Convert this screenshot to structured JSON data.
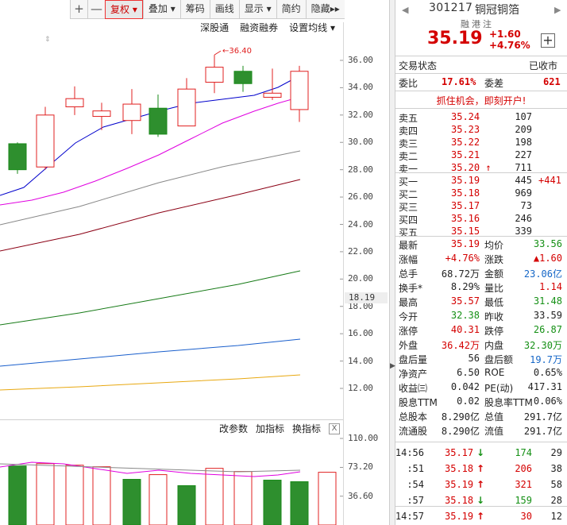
{
  "toolbar": {
    "items": [
      "+",
      "—",
      "复权",
      "叠加",
      "筹码",
      "画线",
      "显示",
      "简约",
      "隐藏"
    ],
    "fuquan_caret": "▾",
    "diejia_caret": "▾",
    "display_caret": "▾",
    "hide_arrow": "▸▸"
  },
  "subbar": {
    "shengutong": "深股通",
    "rongzi": "融资融券",
    "setma": "设置均线"
  },
  "chart": {
    "high_label": "36.40",
    "y_ticks": [
      "36.00",
      "34.00",
      "32.00",
      "30.00",
      "28.00",
      "26.00",
      "24.00",
      "22.00",
      "20.00",
      "18.00",
      "16.00",
      "14.00",
      "12.00"
    ],
    "current": "18.19",
    "ind_ticks": [
      "110.00",
      "73.20",
      "36.60"
    ],
    "ind_buttons": [
      "改参数",
      "加指标",
      "换指标"
    ],
    "close_x": "X"
  },
  "chart_data": {
    "type": "candlestick",
    "candles": [
      {
        "o": 29.9,
        "c": 28.0,
        "h": 30.0,
        "l": 27.7
      },
      {
        "o": 28.2,
        "c": 32.0,
        "h": 32.6,
        "l": 28.0
      },
      {
        "o": 32.6,
        "c": 33.2,
        "h": 34.1,
        "l": 32.0
      },
      {
        "o": 31.9,
        "c": 32.3,
        "h": 32.9,
        "l": 30.9
      },
      {
        "o": 31.6,
        "c": 32.8,
        "h": 33.9,
        "l": 30.6
      },
      {
        "o": 32.5,
        "c": 30.6,
        "h": 33.5,
        "l": 30.4
      },
      {
        "o": 31.2,
        "c": 33.9,
        "h": 34.7,
        "l": 31.2
      },
      {
        "o": 34.4,
        "c": 35.5,
        "h": 36.4,
        "l": 33.6
      },
      {
        "o": 35.2,
        "c": 34.3,
        "h": 35.6,
        "l": 33.7
      },
      {
        "o": 33.3,
        "c": 33.6,
        "h": 35.4,
        "l": 33.1
      },
      {
        "o": 32.4,
        "c": 35.2,
        "h": 35.6,
        "l": 31.5
      }
    ],
    "volume": [
      {
        "v": 75,
        "up": false
      },
      {
        "v": 78,
        "up": true
      },
      {
        "v": 76,
        "up": true
      },
      {
        "v": 74,
        "up": true
      },
      {
        "v": 58,
        "up": false
      },
      {
        "v": 64,
        "up": true
      },
      {
        "v": 50,
        "up": false
      },
      {
        "v": 72,
        "up": true
      },
      {
        "v": 68,
        "up": true
      },
      {
        "v": 57,
        "up": false
      },
      {
        "v": 55,
        "up": false
      },
      {
        "v": 67,
        "up": true
      }
    ]
  },
  "panel": {
    "code": "301217",
    "name": "铜冠铜箔",
    "tags": "融港注",
    "price": "35.19",
    "chg": "+1.60",
    "pct": "+4.76%",
    "plus": "+",
    "status_label": "交易状态",
    "status_val": "已收市",
    "weibi_label": "委比",
    "weibi_val": "17.61%",
    "weicha_label": "委差",
    "weicha_val": "621",
    "ad": "抓住机会，即刻开户!",
    "sells": [
      {
        "l": "卖五",
        "p": "35.24",
        "v": "107"
      },
      {
        "l": "卖四",
        "p": "35.23",
        "v": "209"
      },
      {
        "l": "卖三",
        "p": "35.22",
        "v": "198"
      },
      {
        "l": "卖二",
        "p": "35.21",
        "v": "227"
      },
      {
        "l": "卖一",
        "p": "35.20",
        "v": "711",
        "arrow": "🠕"
      }
    ],
    "buys": [
      {
        "l": "买一",
        "p": "35.19",
        "v": "445",
        "d": "+441"
      },
      {
        "l": "买二",
        "p": "35.18",
        "v": "969"
      },
      {
        "l": "买三",
        "p": "35.17",
        "v": "73"
      },
      {
        "l": "买四",
        "p": "35.16",
        "v": "246"
      },
      {
        "l": "买五",
        "p": "35.15",
        "v": "339"
      }
    ],
    "stats": [
      {
        "a": "最新",
        "av": "35.19",
        "ac": "r",
        "b": "均价",
        "bv": "33.56",
        "bc": "g"
      },
      {
        "a": "涨幅",
        "av": "+4.76%",
        "ac": "r",
        "b": "涨跌",
        "bv": "▲1.60",
        "bc": "r"
      },
      {
        "a": "总手",
        "av": "68.72万",
        "ac": "",
        "b": "金额",
        "bv": "23.06亿",
        "bc": "b"
      },
      {
        "a": "换手*",
        "av": "8.29%",
        "ac": "",
        "b": "量比",
        "bv": "1.14",
        "bc": "r"
      },
      {
        "a": "最高",
        "av": "35.57",
        "ac": "r",
        "b": "最低",
        "bv": "31.48",
        "bc": "g"
      },
      {
        "a": "今开",
        "av": "32.38",
        "ac": "g",
        "b": "昨收",
        "bv": "33.59",
        "bc": ""
      },
      {
        "a": "涨停",
        "av": "40.31",
        "ac": "r",
        "b": "跌停",
        "bv": "26.87",
        "bc": "g"
      },
      {
        "a": "外盘",
        "av": "36.42万",
        "ac": "r",
        "b": "内盘",
        "bv": "32.30万",
        "bc": "g"
      },
      {
        "a": "盘后量",
        "av": "56",
        "ac": "",
        "b": "盘后额",
        "bv": "19.7万",
        "bc": "b"
      },
      {
        "a": "净资产",
        "av": "6.50",
        "ac": "",
        "b": "ROE",
        "bv": "0.65%",
        "bc": ""
      },
      {
        "a": "收益㈢",
        "av": "0.042",
        "ac": "",
        "b": "PE(动)",
        "bv": "417.31",
        "bc": ""
      },
      {
        "a": "股息TTM",
        "av": "0.02",
        "ac": "",
        "b": "股息率TTM",
        "bv": "0.06%",
        "bc": ""
      },
      {
        "a": "总股本",
        "av": "8.290亿",
        "ac": "",
        "b": "总值",
        "bv": "291.7亿",
        "bc": ""
      },
      {
        "a": "流通股",
        "av": "8.290亿",
        "ac": "",
        "b": "流值",
        "bv": "291.7亿",
        "bc": ""
      }
    ],
    "ticks": [
      {
        "t": "14:56",
        "p": "35.17",
        "dir": "↓",
        "pc": "r",
        "v": "174",
        "vc": "g",
        "n": "29"
      },
      {
        "t": ":51",
        "p": "35.18",
        "dir": "↑",
        "pc": "r",
        "v": "206",
        "vc": "r",
        "n": "38"
      },
      {
        "t": ":54",
        "p": "35.19",
        "dir": "↑",
        "pc": "r",
        "v": "321",
        "vc": "r",
        "n": "58"
      },
      {
        "t": ":57",
        "p": "35.18",
        "dir": "↓",
        "pc": "r",
        "v": "159",
        "vc": "g",
        "n": "28"
      },
      {
        "t": "14:57",
        "p": "35.19",
        "dir": "↑",
        "pc": "r",
        "v": "30",
        "vc": "r",
        "n": "12"
      }
    ]
  }
}
